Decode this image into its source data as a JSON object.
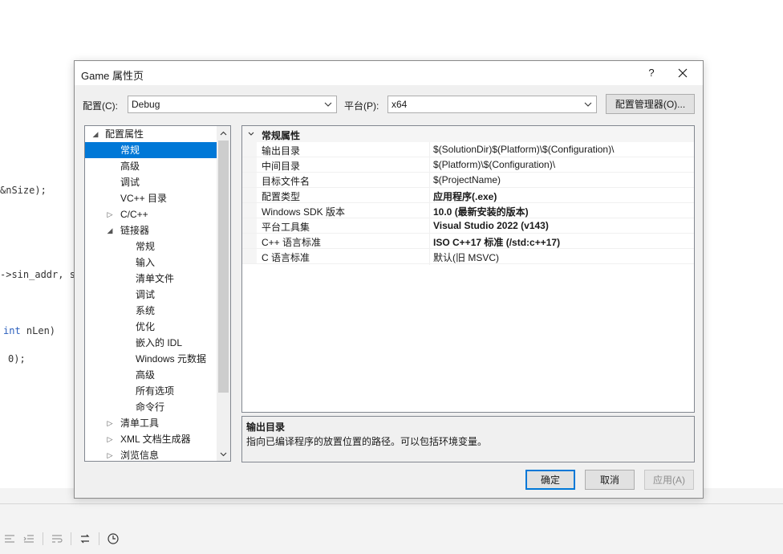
{
  "background_code": {
    "line1": "&nSize);",
    "line2": "->sin_addr, st",
    "line3_kw": "int",
    "line3_rest": " nLen)",
    "line4": "0);"
  },
  "dialog": {
    "title": "Game 属性页",
    "help_label": "?",
    "config_label": "配置(C):",
    "config_value": "Debug",
    "platform_label": "平台(P):",
    "platform_value": "x64",
    "config_manager_label": "配置管理器(O)...",
    "tree": [
      {
        "label": "配置属性",
        "expander": "◢",
        "selected": false
      },
      {
        "label": "常规",
        "expander": "",
        "selected": true
      },
      {
        "label": "高级",
        "expander": "",
        "selected": false
      },
      {
        "label": "调试",
        "expander": "",
        "selected": false
      },
      {
        "label": "VC++ 目录",
        "expander": "",
        "selected": false
      },
      {
        "label": "C/C++",
        "expander": "▷",
        "selected": false
      },
      {
        "label": "链接器",
        "expander": "◢",
        "selected": false
      },
      {
        "label": "常规",
        "expander": "",
        "selected": false
      },
      {
        "label": "输入",
        "expander": "",
        "selected": false
      },
      {
        "label": "清单文件",
        "expander": "",
        "selected": false
      },
      {
        "label": "调试",
        "expander": "",
        "selected": false
      },
      {
        "label": "系统",
        "expander": "",
        "selected": false
      },
      {
        "label": "优化",
        "expander": "",
        "selected": false
      },
      {
        "label": "嵌入的 IDL",
        "expander": "",
        "selected": false
      },
      {
        "label": "Windows 元数据",
        "expander": "",
        "selected": false
      },
      {
        "label": "高级",
        "expander": "",
        "selected": false
      },
      {
        "label": "所有选项",
        "expander": "",
        "selected": false
      },
      {
        "label": "命令行",
        "expander": "",
        "selected": false
      },
      {
        "label": "清单工具",
        "expander": "▷",
        "selected": false
      },
      {
        "label": "XML 文档生成器",
        "expander": "▷",
        "selected": false
      },
      {
        "label": "浏览信息",
        "expander": "▷",
        "selected": false
      }
    ],
    "grid": {
      "section": "常规属性",
      "rows": [
        {
          "key": "输出目录",
          "value": "$(SolutionDir)$(Platform)\\$(Configuration)\\",
          "bold": false
        },
        {
          "key": "中间目录",
          "value": "$(Platform)\\$(Configuration)\\",
          "bold": false
        },
        {
          "key": "目标文件名",
          "value": "$(ProjectName)",
          "bold": false
        },
        {
          "key": "配置类型",
          "value": "应用程序(.exe)",
          "bold": true
        },
        {
          "key": "Windows SDK 版本",
          "value": "10.0 (最新安装的版本)",
          "bold": true
        },
        {
          "key": "平台工具集",
          "value": "Visual Studio 2022 (v143)",
          "bold": true
        },
        {
          "key": "C++ 语言标准",
          "value": "ISO C++17 标准 (/std:c++17)",
          "bold": true
        },
        {
          "key": "C 语言标准",
          "value": "默认(旧 MSVC)",
          "bold": false
        }
      ]
    },
    "description": {
      "title": "输出目录",
      "text": "指向已编译程序的放置位置的路径。可以包括环境变量。"
    },
    "buttons": {
      "ok": "确定",
      "cancel": "取消",
      "apply": "应用(A)"
    }
  }
}
